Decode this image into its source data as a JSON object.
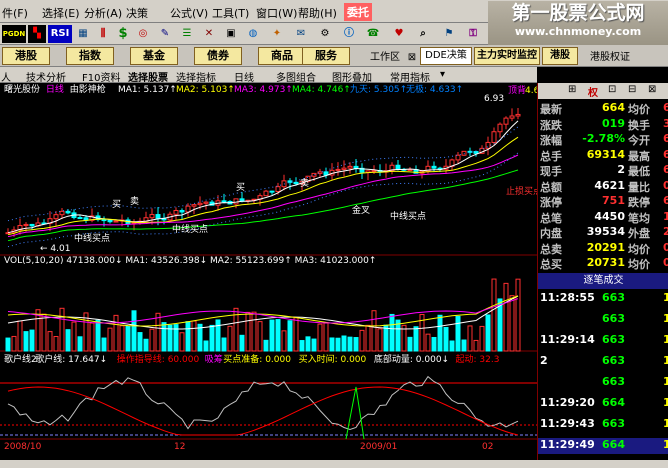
{
  "menu": {
    "items": [
      "件(F)",
      "选择(E)",
      "分析(A)",
      "决策",
      "公式(V)",
      "工具(T)",
      "窗口(W)",
      "帮助(H)",
      "委托"
    ]
  },
  "watermark": {
    "title": "第一股票公式网",
    "url": "www.chnmoney.com"
  },
  "toolbar": {
    "buttons": [
      "PGDN",
      "RSI",
      "$"
    ]
  },
  "sectors": {
    "buttons": [
      "港股",
      "指数",
      "基金",
      "债券",
      "商品",
      "服务",
      "工作区",
      "DDE决策",
      "主力实时监控",
      "港股",
      "港股权证"
    ]
  },
  "tabs": [
    "人",
    "技术分析",
    "F10资料",
    "选择股票",
    "选择指标",
    "日线",
    "多图组合",
    "图形叠加",
    "常用指标"
  ],
  "chart": {
    "title": "曙光股份",
    "period": "日线",
    "indicator": "由影神枪",
    "ma": [
      {
        "label": "MA1: 5.137↑",
        "color": "#ffffff"
      },
      {
        "label": "MA2: 5.103↑",
        "color": "#ffff00"
      },
      {
        "label": "MA3: 4.973↑",
        "color": "#ff00ff"
      },
      {
        "label": "MA4: 4.746↑",
        "color": "#00ff00"
      },
      {
        "label": "九天: 5.305↑",
        "color": "#0080ff"
      },
      {
        "label": "无极: 4.633↑",
        "color": "#0080ff"
      }
    ],
    "tag_top": "顶背",
    "tag_top_value": "6.93",
    "tag_bottom": "← 4.01",
    "price_last": "4.6",
    "annotations": [
      "中线买点",
      "中线买点",
      "中线买点",
      "金叉",
      "买",
      "卖",
      "买",
      "卖",
      "止损买点"
    ],
    "vol_label": "VOL(5,10,20) 47138.000↓ MA1: 43526.398↓ MA2: 55123.699↑ MA3: 41023.000↑",
    "osc_labels": [
      {
        "t": "歌户线2",
        "c": "#ffffff"
      },
      {
        "t": "歌户线: 17.647↓",
        "c": "#ffffff"
      },
      {
        "t": "操作指导线: 60.000",
        "c": "#ff0000"
      },
      {
        "t": "吸筹",
        "c": "#ff00ff"
      },
      {
        "t": "买点准备: 0.000",
        "c": "#ffff00"
      },
      {
        "t": "买入时间: 0.000",
        "c": "#ffff00"
      },
      {
        "t": "底部动量: 0.000↓",
        "c": "#ffffff"
      },
      {
        "t": "起动: 32.3",
        "c": "#ff0000"
      }
    ],
    "dates": [
      "2008/10",
      "12",
      "2009/01",
      "02"
    ]
  },
  "quote": {
    "rows": [
      {
        "k": "最新",
        "v": "664",
        "k2": "均价",
        "v2": "6"
      },
      {
        "k": "涨跌",
        "v": "019",
        "k2": "换手",
        "v2": "3.78"
      },
      {
        "k": "涨幅",
        "v": "-2.78%",
        "k2": "今开",
        "v2": "6"
      },
      {
        "k": "总手",
        "v": "69314",
        "k2": "最高",
        "v2": "6"
      },
      {
        "k": "现手",
        "v": "2",
        "k2": "最低",
        "v2": "6"
      },
      {
        "k": "总额",
        "v": "4621",
        "k2": "量比",
        "v2": "0"
      },
      {
        "k": "涨停",
        "v": "751",
        "k2": "跌停",
        "v2": "6"
      },
      {
        "k": "总笔",
        "v": "4450",
        "k2": "笔均",
        "v2": "15"
      },
      {
        "k": "内盘",
        "v": "39534",
        "k2": "外盘",
        "v2": "2978"
      },
      {
        "k": "总卖",
        "v": "20291",
        "k2": "均价",
        "v2": "0"
      },
      {
        "k": "总买",
        "v": "20731",
        "k2": "均价",
        "v2": "0"
      }
    ],
    "ticks_title": "逐笔成交",
    "ticks": [
      {
        "t": "11:28:55",
        "p": "663",
        "v": "10"
      },
      {
        "t": "",
        "p": "663",
        "v": "10"
      },
      {
        "t": "11:29:14",
        "p": "663",
        "v": "10"
      },
      {
        "t": "2",
        "p": "663",
        "v": "1"
      },
      {
        "t": "",
        "p": "663",
        "v": "1"
      },
      {
        "t": "11:29:20",
        "p": "664",
        "v": "1"
      },
      {
        "t": "11:29:43",
        "p": "663",
        "v": "1"
      },
      {
        "t": "11:29:49",
        "p": "664",
        "v": "1"
      }
    ]
  },
  "colors": {
    "up": "#ff3030",
    "down": "#00ffff",
    "grid": "#800000",
    "label": "#c0c0c0"
  },
  "chart_data": {
    "type": "line",
    "x": [
      "2008/10",
      "12",
      "2009/01",
      "02"
    ],
    "series": [
      {
        "name": "MA1",
        "values": [
          4.2,
          4.4,
          4.7,
          5.1
        ]
      }
    ]
  }
}
